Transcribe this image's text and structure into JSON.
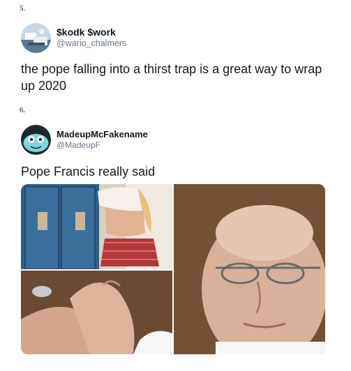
{
  "items": [
    {
      "number": "5.",
      "display_name": "$kodk $work",
      "handle": "@wario_chalmers",
      "text": "the pope falling into a thirst trap is a great way to wrap up 2020"
    },
    {
      "number": "6.",
      "display_name": "MadeupMcFakename",
      "handle": "@MadeupF",
      "text": "Pope Francis really said"
    }
  ],
  "colors": {
    "handle": "#657786",
    "text": "#14171a"
  },
  "media_panels": [
    "locker-photo",
    "fingers-photo",
    "pope-face-photo"
  ]
}
